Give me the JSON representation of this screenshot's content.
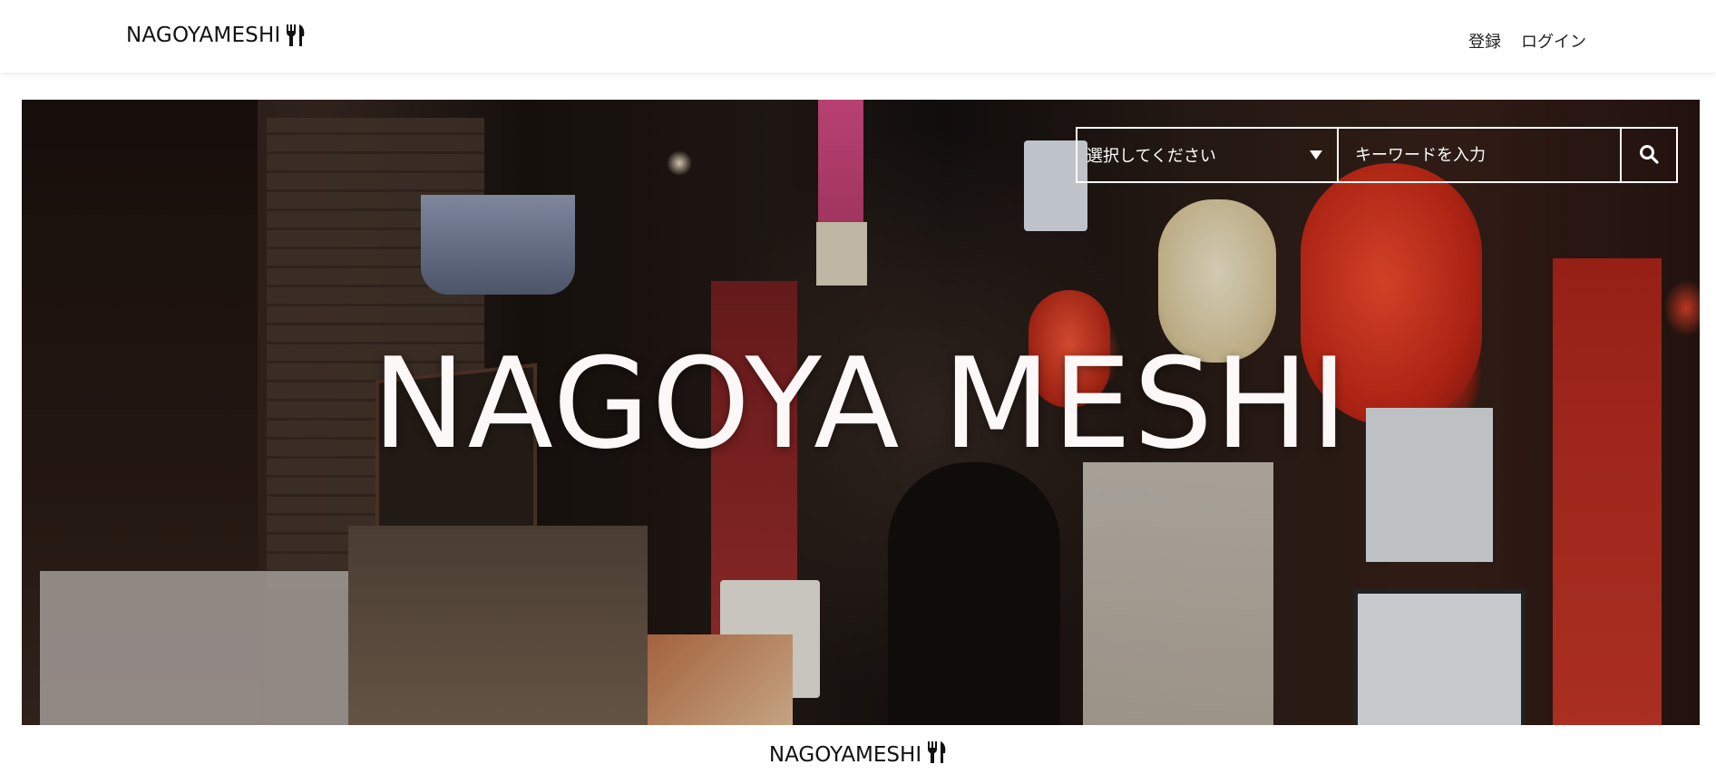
{
  "header": {
    "brand": "NAGOYAMESHI",
    "brand_icon": "fork-knife-icon",
    "nav": {
      "register": "登録",
      "login": "ログイン"
    }
  },
  "hero": {
    "title": "NAGOYA MESHI",
    "search": {
      "category_selected": "選択してください",
      "keyword_placeholder": "キーワードを入力",
      "submit_icon": "search-icon"
    }
  },
  "footer": {
    "brand": "NAGOYAMESHI",
    "brand_icon": "fork-knife-icon"
  },
  "colors": {
    "hero_text": "#fdf8f8",
    "search_border": "#ffffff"
  }
}
